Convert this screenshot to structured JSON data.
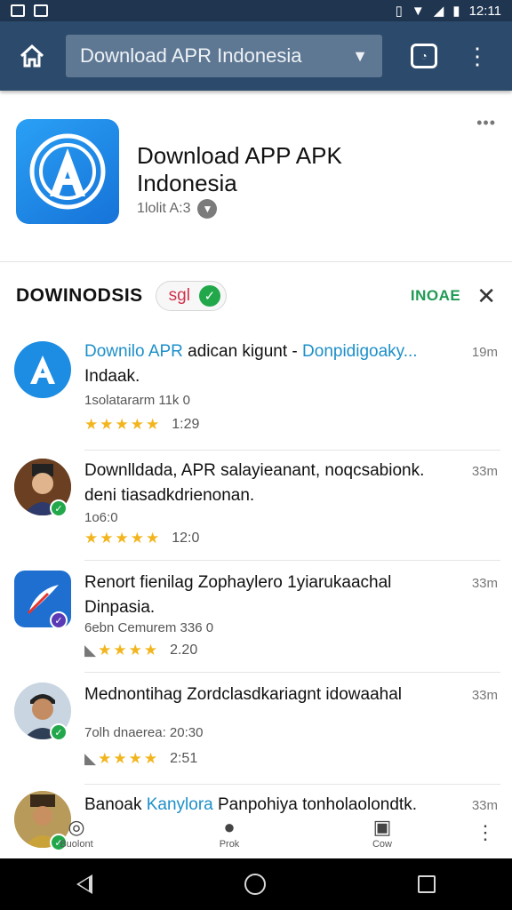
{
  "status_bar": {
    "time": "12:11"
  },
  "toolbar": {
    "url_text": "Download APR Indonesia"
  },
  "app": {
    "title": "Download APP APK Indonesia",
    "meta": "1lolit A:3",
    "icon_color": "#1a8ae6"
  },
  "section": {
    "title": "DOWINODSIS",
    "chip_label": "sgl",
    "action_label": "INOAE"
  },
  "items": [
    {
      "title_pre": "Downilo APR",
      "title_mid": " adican kigunt - ",
      "title_link": "Donpidigoaky...",
      "line2": "Indaak.",
      "sub": "1solatararm 11k 0",
      "stars": 4.5,
      "rating_text": "1:29",
      "time": "19m"
    },
    {
      "title": "Downlldada, APR salayieanant, noqcsabionk.",
      "line2": "deni tiasadkdrienonan.",
      "sub": "1o6:0",
      "stars": 4.5,
      "rating_text": "12:0",
      "time": "33m"
    },
    {
      "title": "Renort fienilag Zophaylero 1yiarukaachal",
      "line2": "Dinpasia.",
      "sub": "6ebn Cemurem 336 0",
      "stars": 4,
      "rating_text": "2.20",
      "time": "33m"
    },
    {
      "title": "Mednontihag Zordclasdkariagnt idowaahal",
      "line2": "",
      "sub": "7olh dnaerea: 20:30",
      "stars": 4,
      "rating_text": "2:51",
      "time": "33m"
    },
    {
      "title_pre": "Banoak ",
      "title_link": "Kanylora",
      "title_mid": " Panpohiya tonholaolondtk.",
      "line2": "",
      "sub": "",
      "stars": 0,
      "rating_text": "",
      "time": "33m"
    }
  ],
  "bottom_tabs": [
    {
      "label": "Buolont",
      "icon": "refresh-icon"
    },
    {
      "label": "Prok",
      "icon": "drop-icon"
    },
    {
      "label": "Cow",
      "icon": "folder-icon"
    }
  ]
}
